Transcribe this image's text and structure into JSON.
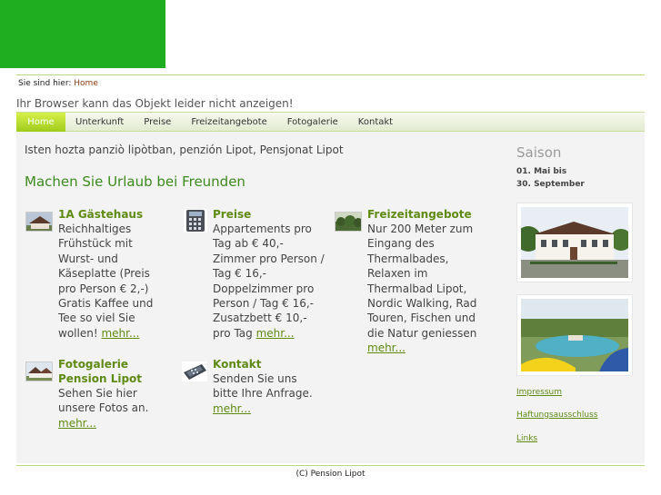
{
  "breadcrumb": {
    "prefix": "Sie sind hier:",
    "home": "Home"
  },
  "browser_message": "Ihr Browser kann das Objekt leider nicht anzeigen!",
  "nav": [
    {
      "label": "Home",
      "active": true
    },
    {
      "label": "Unterkunft"
    },
    {
      "label": "Preise"
    },
    {
      "label": "Freizeitangebote"
    },
    {
      "label": "Fotogalerie"
    },
    {
      "label": "Kontakt"
    }
  ],
  "main": {
    "intro": "Isten hozta panziò lipòtban, penzión Lipot, Pensjonat Lipot",
    "heading": "Machen Sie Urlaub bei Freunden",
    "more_label": "mehr...",
    "cards": [
      {
        "title": "1A Gästehaus",
        "text": "Reichhaltiges Frühstück mit Wurst- und Käseplatte (Preis pro Person € 2,-) Gratis Kaffee und Tee so viel Sie wollen!",
        "icon": "house-photo-icon"
      },
      {
        "title": "Preise",
        "text": "Appartements pro Tag ab € 40,- Zimmer pro Person / Tag € 16,- Doppelzimmer pro Person / Tag € 16,- Zusatzbett € 10,- pro Tag",
        "icon": "calculator-icon"
      },
      {
        "title": "Freizeitangebote",
        "text": "Nur 200 Meter zum Eingang des Thermalbades, Relaxen im Thermalbad Lipot, Nordic Walking, Rad Touren, Fischen und die Natur geniessen",
        "icon": "landscape-photo-icon"
      },
      {
        "title": "Fotogalerie Pension Lipot",
        "text": "Sehen Sie hier unsere Fotos an.",
        "icon": "gallery-photo-icon"
      },
      {
        "title": "Kontakt",
        "text": "Senden Sie uns bitte Ihre Anfrage.",
        "icon": "telephone-icon"
      }
    ]
  },
  "sidebar": {
    "title": "Saison",
    "date_from": "01. Mai bis",
    "date_to": "30. September",
    "links": [
      "Impressum",
      "Haftungsausschluss",
      "Links"
    ]
  },
  "footer": "(C) Pension Lipot",
  "colors": {
    "brand_green": "#1fae1f",
    "nav_active": "#9fcb1d",
    "link_green": "#5f8a14",
    "heading_green": "#3d8a1e"
  }
}
